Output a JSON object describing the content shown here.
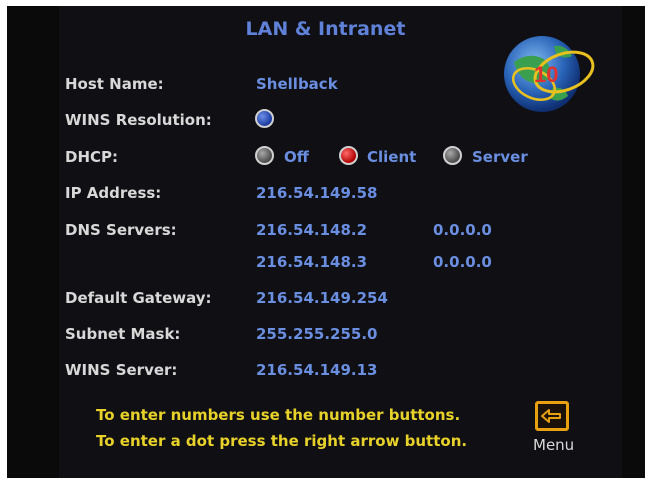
{
  "title": "LAN & Intranet",
  "fields": {
    "host_name_label": "Host Name:",
    "host_name_value": "Shellback",
    "wins_resolution_label": "WINS Resolution:",
    "dhcp_label": "DHCP:",
    "dhcp_options": [
      "Off",
      "Client",
      "Server"
    ],
    "dhcp_selected": "Client",
    "ip_address_label": "IP Address:",
    "ip_address_value": "216.54.149.58",
    "dns_servers_label": "DNS Servers:",
    "dns_servers": [
      "216.54.148.2",
      "0.0.0.0",
      "216.54.148.3",
      "0.0.0.0"
    ],
    "default_gateway_label": "Default Gateway:",
    "default_gateway_value": "216.54.149.254",
    "subnet_mask_label": "Subnet Mask:",
    "subnet_mask_value": "255.255.255.0",
    "wins_server_label": "WINS Server:",
    "wins_server_value": "216.54.149.13"
  },
  "hints": [
    "To enter numbers use the number buttons.",
    "To enter a dot press the right arrow button."
  ],
  "menu": {
    "label": "Menu",
    "icon": "back-arrow-icon"
  },
  "logo": {
    "icon": "globe-icon",
    "text": "10"
  },
  "colors": {
    "background": "#0f0f14",
    "value_blue": "#6a8ee0",
    "label_white": "#d8d8d8",
    "hint_yellow": "#e8d22a",
    "menu_orange": "#e6a010"
  }
}
